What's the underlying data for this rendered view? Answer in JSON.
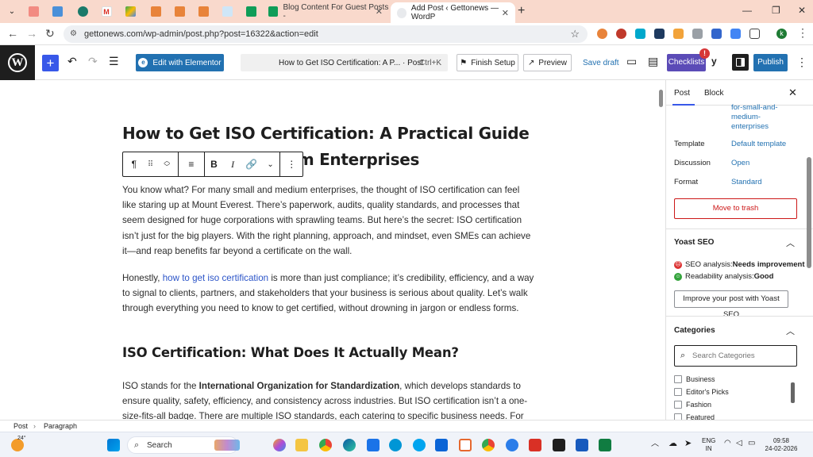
{
  "browser": {
    "tabs": [
      {
        "label": "Blog Content For Guest Posts -",
        "active": false
      },
      {
        "label": "Add Post ‹ Gettonews — WordP",
        "active": true
      }
    ],
    "url": "gettonews.com/wp-admin/post.php?post=16322&action=edit"
  },
  "wp_header": {
    "edit_with_elementor": "Edit with Elementor",
    "command_title": "How to Get ISO Certification: A P... · Post",
    "command_shortcut": "Ctrl+K",
    "finish_setup": "Finish Setup",
    "preview": "Preview",
    "save_draft": "Save draft",
    "checklists": "Checklists",
    "checklists_badge": "!",
    "publish": "Publish"
  },
  "post": {
    "title": "How to Get ISO Certification: A Practical Guide for Small and Medium Enterprises",
    "paragraphs": [
      "You know what? For many small and medium enterprises, the thought of ISO certification can feel like staring up at Mount Everest. There’s paperwork, audits, quality standards, and processes that seem designed for huge corporations with sprawling teams. But here’s the secret: ISO certification isn’t just for the big players. With the right planning, approach, and mindset, even SMEs can achieve it—and reap benefits far beyond a certificate on the wall."
    ],
    "p2_before": "Honestly, ",
    "p2_link": "how to get iso certification",
    "p2_after": " is more than just compliance; it’s credibility, efficiency, and a way to signal to clients, partners, and stakeholders that your business is serious about quality. Let’s walk through everything you need to know to get certified, without drowning in jargon or endless forms.",
    "heading2": "ISO Certification: What Does It Actually Mean?",
    "p3_before": "ISO stands for the ",
    "p3_bold": "International Organization for Standardization",
    "p3_after": ", which develops standards to ensure quality, safety, efficiency, and consistency across industries. But ISO certification isn’t a one-size-fits-all badge. There are multiple ISO standards, each catering to specific business needs. For"
  },
  "sidebar": {
    "tab_post": "Post",
    "tab_block": "Block",
    "slug": "for-small-and-medium-enterprises",
    "rows": [
      {
        "label": "Template",
        "value": "Default template"
      },
      {
        "label": "Discussion",
        "value": "Open"
      },
      {
        "label": "Format",
        "value": "Standard"
      }
    ],
    "move_to_trash": "Move to trash",
    "yoast": {
      "heading": "Yoast SEO",
      "seo_label": "SEO analysis: ",
      "seo_value": "Needs improvement",
      "read_label": "Readability analysis: ",
      "read_value": "Good",
      "improve": "Improve your post with Yoast SEO"
    },
    "categories": {
      "heading": "Categories",
      "search_placeholder": "Search Categories",
      "items": [
        "Business",
        "Editor's Picks",
        "Fashion",
        "Featured"
      ]
    }
  },
  "footer": {
    "crumb_post": "Post",
    "crumb_sep": "›",
    "crumb_block": "Paragraph"
  },
  "taskbar": {
    "weather": "24°",
    "search": "Search",
    "lang1": "ENG",
    "lang2": "IN",
    "time": "09:58",
    "date": "24-02-2026"
  },
  "colors": {
    "accent": "#2271b1",
    "wp_blue": "#3858e9",
    "checklists": "#5b4bb7",
    "trash": "#cc1818",
    "tabstrip": "#f9d9cc"
  }
}
